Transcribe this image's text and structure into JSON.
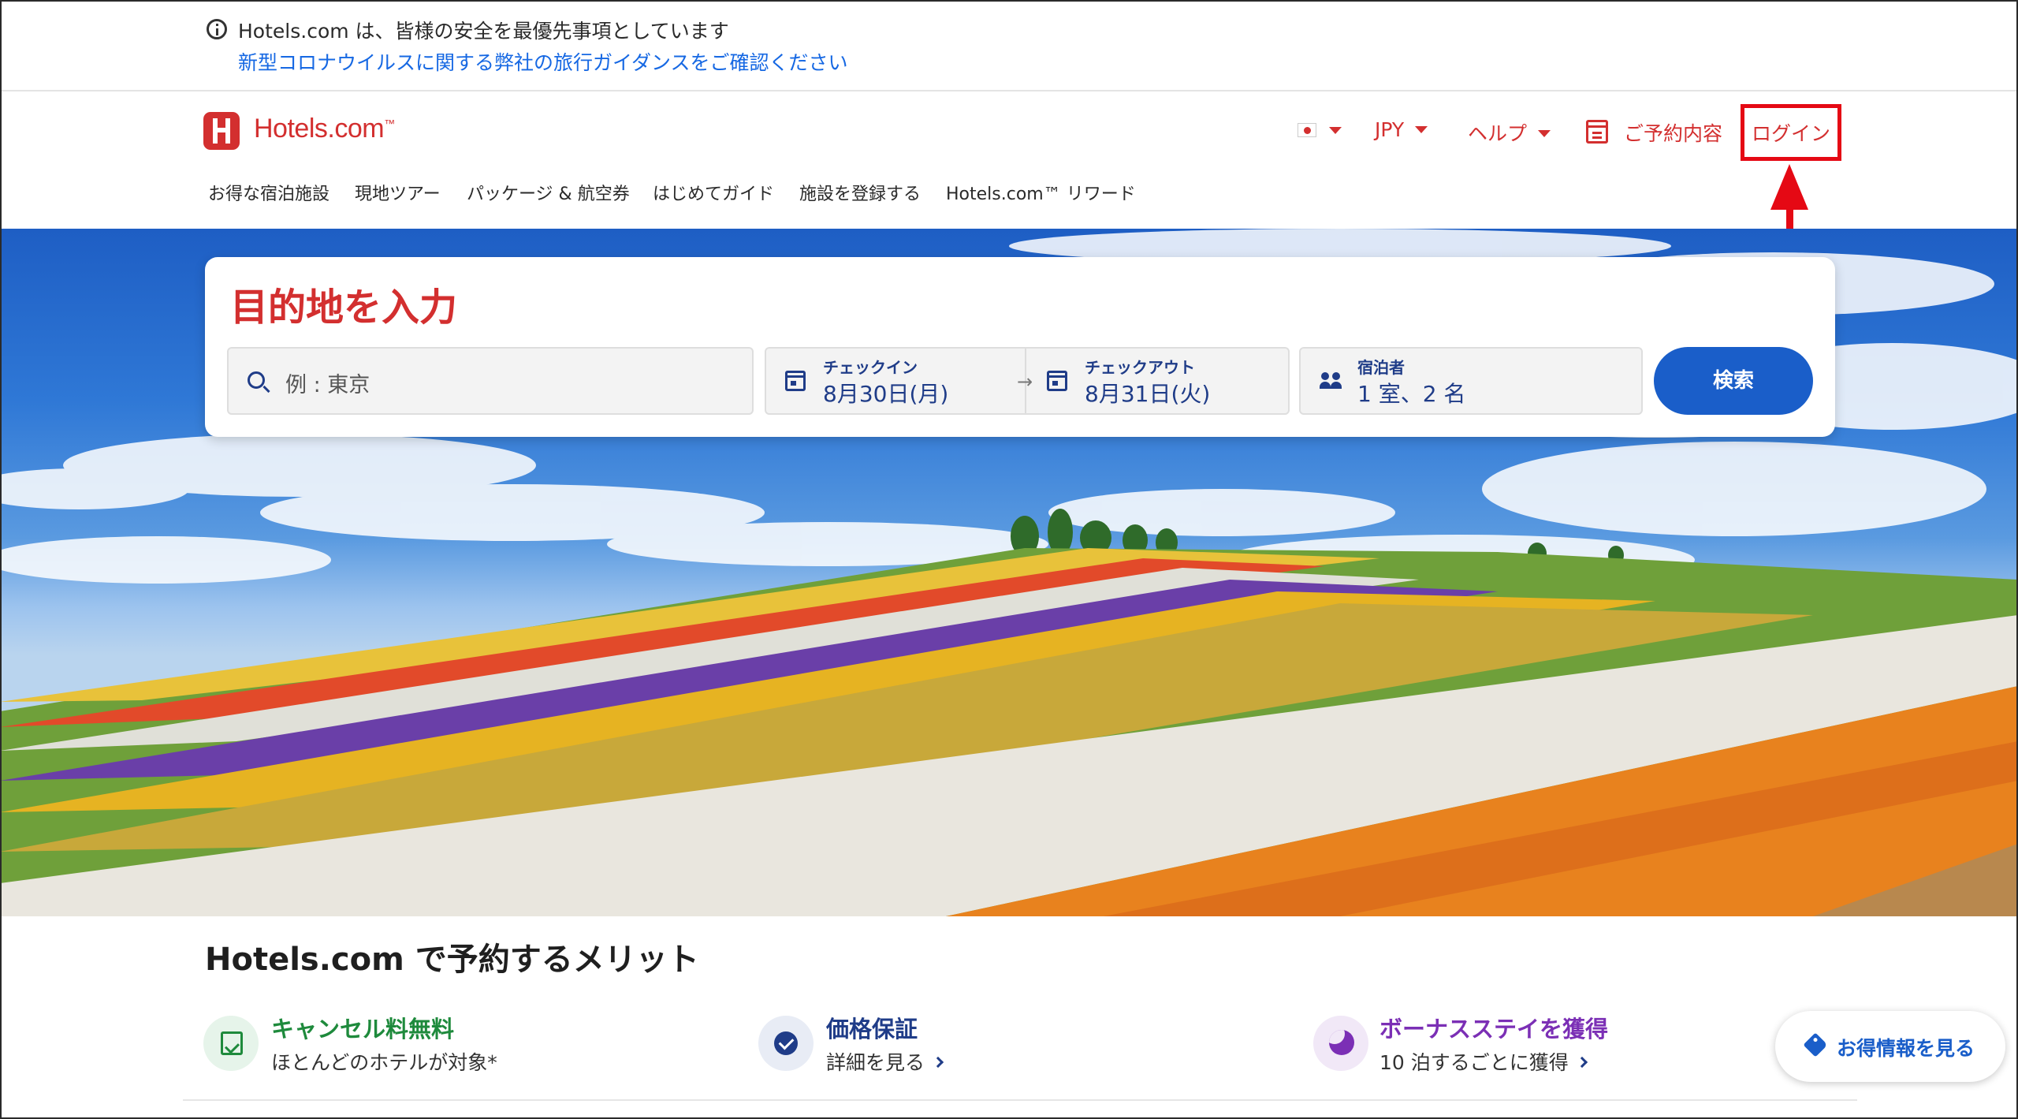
{
  "notice": {
    "message": "Hotels.com は、皆様の安全を最優先事項としています",
    "link": "新型コロナウイルスに関する弊社の旅行ガイダンスをご確認ください"
  },
  "header": {
    "logo": "Hotels.com",
    "logo_tm": "™",
    "currency": "JPY",
    "help": "ヘルプ",
    "bookings": "ご予約内容",
    "login": "ログイン"
  },
  "nav": {
    "items": [
      "お得な宿泊施設",
      "現地ツアー",
      "パッケージ & 航空券",
      "はじめてガイド",
      "施設を登録する",
      "Hotels.com™ リワード"
    ]
  },
  "search": {
    "title": "目的地を入力",
    "destination_placeholder": "例 : 東京",
    "checkin_label": "チェックイン",
    "checkin_value": "8月30日(月)",
    "checkout_label": "チェックアウト",
    "checkout_value": "8月31日(火)",
    "guests_label": "宿泊者",
    "guests_value": "1 室、2 名",
    "button": "検索"
  },
  "benefits": {
    "title": "Hotels.com で予約するメリット",
    "items": [
      {
        "title": "キャンセル料無料",
        "subtitle": "ほとんどのホテルが対象*",
        "color": "#1e8a3c"
      },
      {
        "title": "価格保証",
        "subtitle": "詳細を見る",
        "color": "#1f3c88"
      },
      {
        "title": "ボーナスステイを獲得",
        "subtitle": "10 泊するごとに獲得",
        "color": "#7b2fb5"
      }
    ]
  },
  "deals_button": "お得情報を見る",
  "colors": {
    "brand_red": "#d32f2f",
    "primary_blue": "#1a5ec9",
    "annotation_red": "#e50914"
  },
  "icons": [
    "info-icon",
    "hotels-logo-icon",
    "japan-flag-icon",
    "calendar-icon",
    "search-icon",
    "people-icon",
    "tag-icon",
    "moon-icon",
    "check-badge-icon"
  ]
}
